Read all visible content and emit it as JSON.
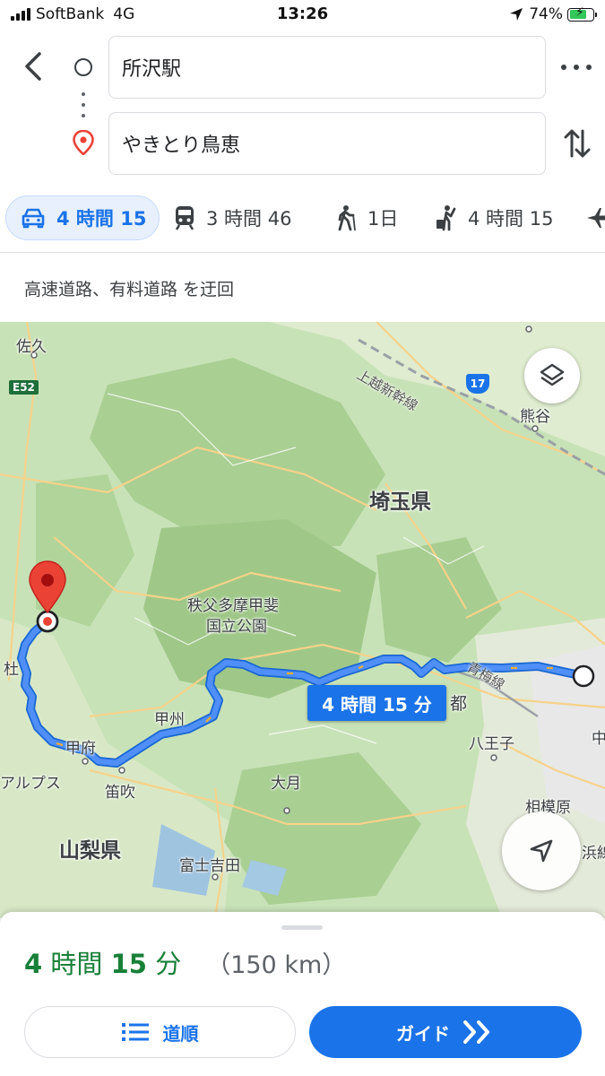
{
  "status_bar": {
    "carrier": "SoftBank",
    "network": "4G",
    "time": "13:26",
    "battery": "74%",
    "battery_level": 0.74
  },
  "search": {
    "origin": "所沢駅",
    "destination": "やきとり鳥恵"
  },
  "modes": [
    {
      "icon": "car-icon",
      "label": "4 時間 15",
      "active": true
    },
    {
      "icon": "train-icon",
      "label": "3 時間 46",
      "active": false
    },
    {
      "icon": "walk-icon",
      "label": "1日",
      "active": false
    },
    {
      "icon": "rideshare-icon",
      "label": "4 時間 15",
      "active": false
    },
    {
      "icon": "flight-icon",
      "label": "",
      "active": false
    }
  ],
  "route_note": "高速道路、有料道路 を迂回",
  "map": {
    "labels": {
      "saku": "佐久",
      "joetsu_shinkansen": "上越新幹線",
      "kumagaya": "熊谷",
      "saitama": "埼玉県",
      "chichibu1": "秩父多摩甲斐",
      "chichibu2": "国立公園",
      "sha": "杜",
      "koshu": "甲州",
      "kofu": "甲府",
      "tokyo_partial": "都",
      "ome_line": "青梅線",
      "hachioji": "八王子",
      "naka_partial": "中",
      "alps": "アルプス",
      "fuefuki": "笛吹",
      "otsuki": "大月",
      "sagamihara": "相模原",
      "hama_partial": "浜線",
      "yamanashi": "山梨県",
      "fujiyoshida": "富士吉田",
      "e52": "E52",
      "route17": "17"
    },
    "route_time_chip": "4 時間 15 分",
    "colors": {
      "route": "#4285f4",
      "route_outline": "#1967d2",
      "forest": "#b6d8a5",
      "pin": "#ea4335"
    }
  },
  "summary": {
    "dur_h": "4",
    "dur_h_unit": " 時間 ",
    "dur_m": "15",
    "dur_m_unit": " 分",
    "distance": "（150 km）"
  },
  "buttons": {
    "steps": "道順",
    "guide": "ガイド"
  }
}
